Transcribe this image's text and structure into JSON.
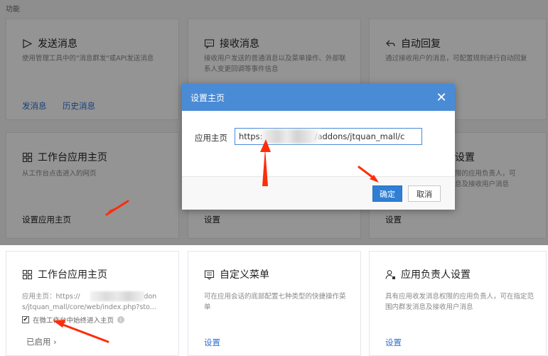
{
  "section_label": "功能",
  "top_cards": [
    {
      "title": "发送消息",
      "icon": "send-icon",
      "desc": "使用管理工具中的\"消息群发\"或API发送消息",
      "links": [
        "发消息",
        "历史消息"
      ]
    },
    {
      "title": "接收消息",
      "icon": "chat-icon",
      "desc": "接收用户发送的普通消息以及菜单操作、外部联系人变更回调等事件信息"
    },
    {
      "title": "自动回复",
      "icon": "reply-icon",
      "desc": "通过接收用户的消息，可配置规则进行自动回复"
    },
    {
      "title": "工作台应用主页",
      "icon": "grid-icon",
      "desc": "从工作台点击进入的网页",
      "link": "设置应用主页"
    },
    {
      "link": "设置"
    },
    {
      "title_partial": "设置",
      "desc_partial_1": "限的应用负责人，可",
      "desc_partial_2": "息及接收用户消息",
      "link": "设置"
    }
  ],
  "modal": {
    "title": "设置主页",
    "close_symbol": "✕",
    "label": "应用主页",
    "input_value": "https:                    /addons/jtquan_mall/c",
    "ok_label": "确定",
    "cancel_label": "取消"
  },
  "bottom_cards": [
    {
      "title": "工作台应用主页",
      "icon": "grid-icon",
      "url_line1_prefix": "应用主页：https://",
      "url_line1_suffix": "addon",
      "url_line2": "s/jtquan_mall/core/web/index.php?sto...",
      "checkbox_label": "在微工作台中始终进入主页",
      "checked": true,
      "status": "已启用",
      "status_chevron": "›"
    },
    {
      "title": "自定义菜单",
      "icon": "menu-icon",
      "desc": "可在应用会话的底部配置七种类型的快捷操作菜单",
      "link": "设置"
    },
    {
      "title": "应用负责人设置",
      "icon": "admin-icon",
      "desc": "具有应用收发消息权限的应用负责人，可在指定范围内群发消息及接收用户消息",
      "link": "设置"
    }
  ],
  "colors": {
    "accent": "#2f7fd4",
    "modal_header": "#4a8bd6",
    "arrow": "#ff2d0a",
    "link": "#2c6fd1"
  }
}
